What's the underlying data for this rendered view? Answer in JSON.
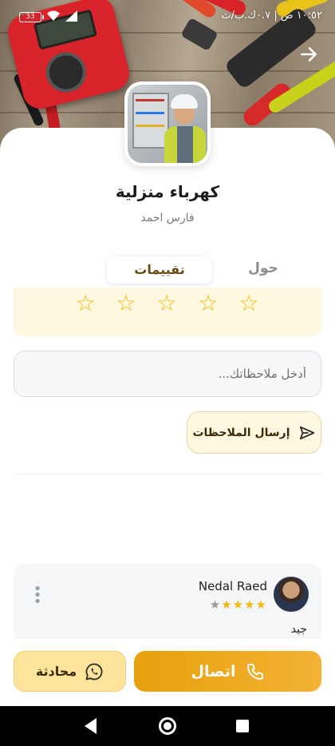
{
  "status_bar": {
    "time": "١٠:٥٢ ص | ٠.٧ك.ب/ث",
    "battery": "33"
  },
  "service": {
    "title": "كهرباء منزلية",
    "provider": "فارس احمد"
  },
  "tabs": {
    "about": "حول",
    "reviews": "تقييمات",
    "active": "reviews"
  },
  "rating_input": {
    "max": 5,
    "value": 0,
    "star": "☆"
  },
  "feedback": {
    "placeholder": "أدخل ملاحظاتك...",
    "value": "",
    "send_label": "إرسال الملاحظات"
  },
  "reviews": [
    {
      "name": "Nedal Raed",
      "rating": 4,
      "max": 5,
      "text": "جيد"
    }
  ],
  "actions": {
    "call_label": "اتصال",
    "chat_label": "محادثة"
  },
  "colors": {
    "accent": "#e8a00c",
    "accent_light": "#fde49a",
    "star": "#f0b90b",
    "tint_bg": "#fff8e1"
  }
}
